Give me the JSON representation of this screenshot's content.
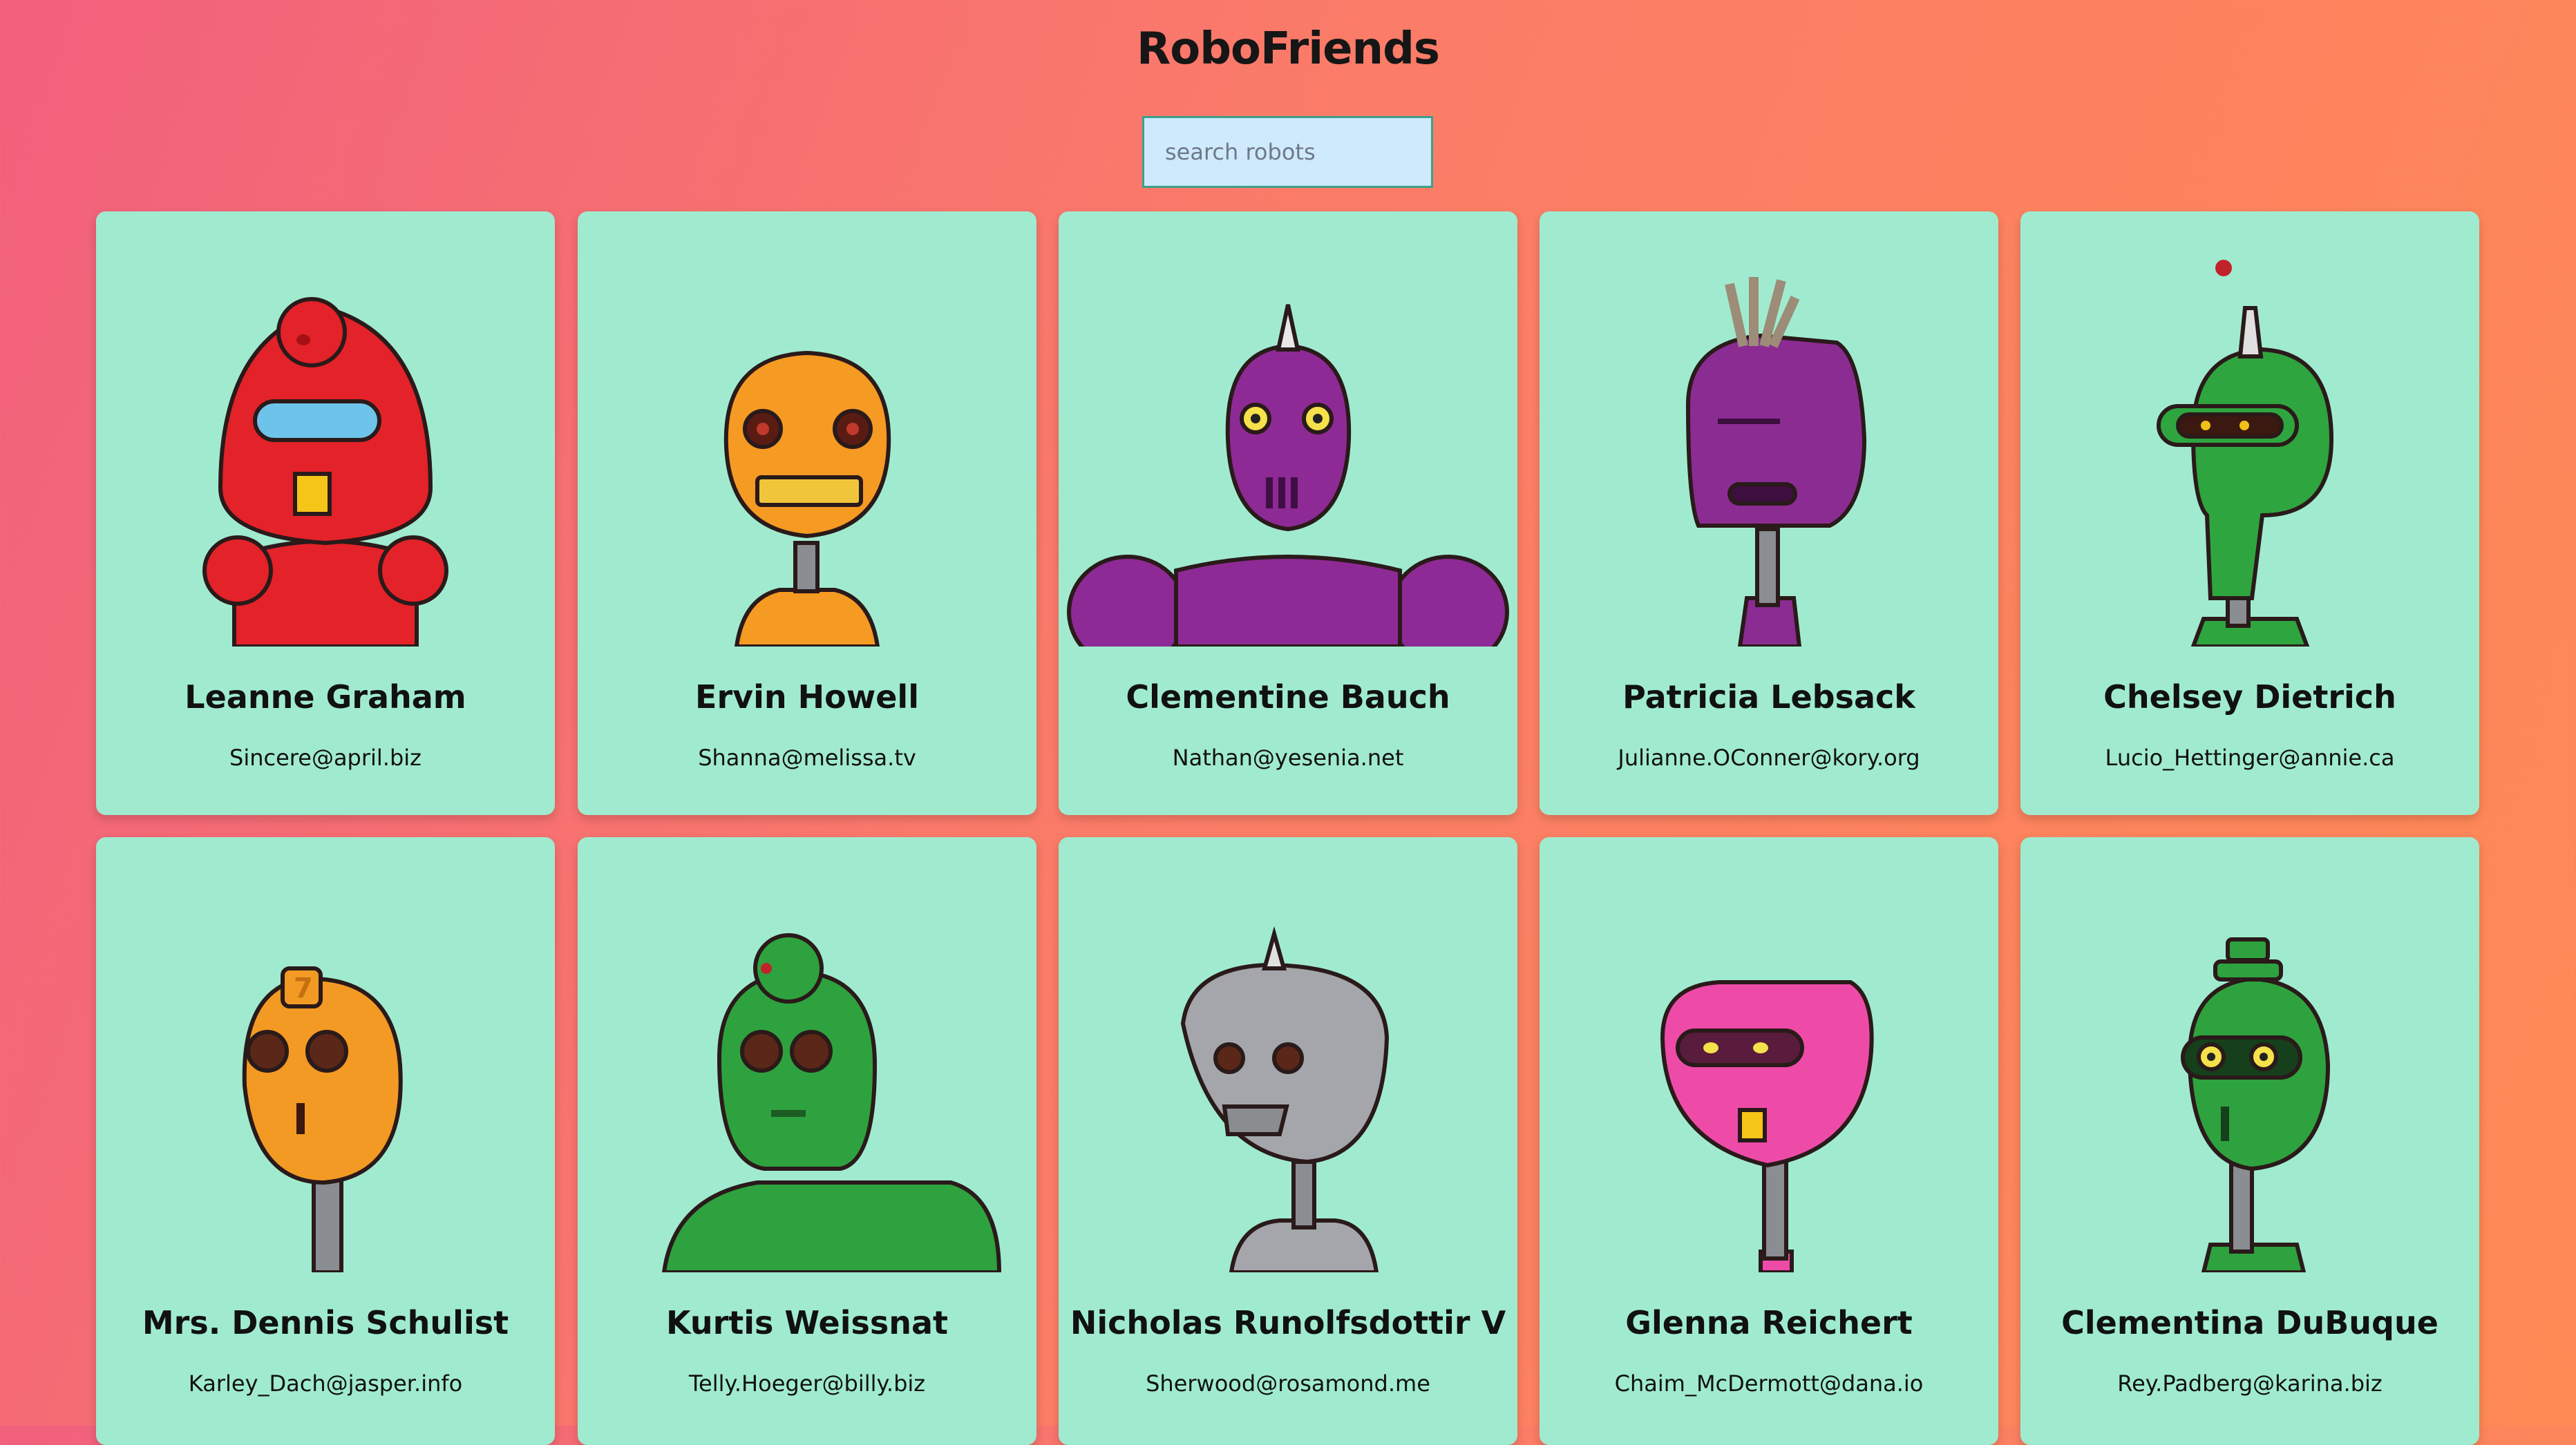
{
  "app": {
    "title": "RoboFriends"
  },
  "search": {
    "placeholder": "search robots",
    "value": ""
  },
  "robots": [
    {
      "name": "Leanne Graham",
      "email": "Sincere@april.biz",
      "color": "#e42229"
    },
    {
      "name": "Ervin Howell",
      "email": "Shanna@melissa.tv",
      "color": "#f59a23"
    },
    {
      "name": "Clementine Bauch",
      "email": "Nathan@yesenia.net",
      "color": "#8e2a95"
    },
    {
      "name": "Patricia Lebsack",
      "email": "Julianne.OConner@kory.org",
      "color": "#8b2c93"
    },
    {
      "name": "Chelsey Dietrich",
      "email": "Lucio_Hettinger@annie.ca",
      "color": "#2fa53f"
    },
    {
      "name": "Mrs. Dennis Schulist",
      "email": "Karley_Dach@jasper.info",
      "color": "#f39a24"
    },
    {
      "name": "Kurtis Weissnat",
      "email": "Telly.Hoeger@billy.biz",
      "color": "#2ea23e"
    },
    {
      "name": "Nicholas Runolfsdottir V",
      "email": "Sherwood@rosamond.me",
      "color": "#a4a6ab"
    },
    {
      "name": "Glenna Reichert",
      "email": "Chaim_McDermott@dana.io",
      "color": "#ee4ba9"
    },
    {
      "name": "Clementina DuBuque",
      "email": "Rey.Padberg@karina.biz",
      "color": "#2ea23e"
    }
  ]
}
